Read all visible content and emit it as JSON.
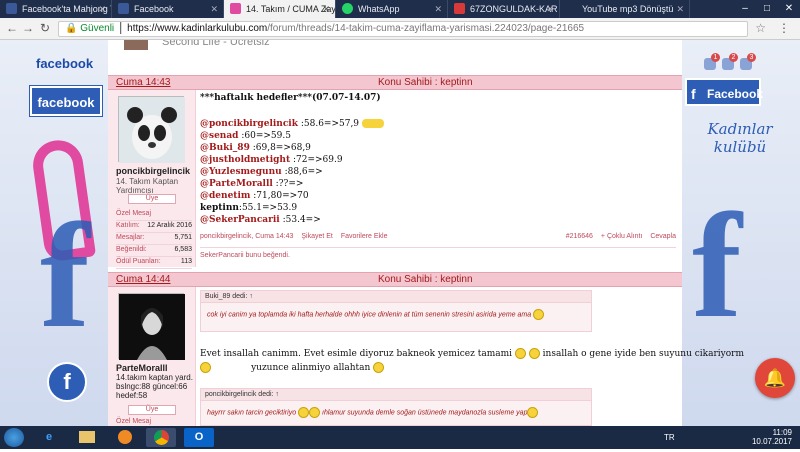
{
  "browser": {
    "tabs": [
      {
        "title": "Facebook'ta Mahjong T",
        "fav": "#3b5998"
      },
      {
        "title": "Facebook",
        "fav": "#3b5998"
      },
      {
        "title": "14. Takım / CUMA Zayıf",
        "fav": "#e04aa0",
        "active": true
      },
      {
        "title": "WhatsApp",
        "fav": "#25d366"
      },
      {
        "title": "67ZONGULDAK-KAR",
        "fav": "#d83a3a"
      },
      {
        "title": "YouTube mp3 Dönüştü",
        "fav": "#c33"
      }
    ],
    "address": {
      "secure_label": "Güvenli",
      "host": "https://www.kadinlarkulubu.com",
      "path": "/forum/threads/14-takim-cuma-zayiflama-yarismasi.224023/page-21665"
    }
  },
  "sidebar_left": {
    "facebook_text": "facebook",
    "facebook_box": "facebook",
    "circle": "f"
  },
  "sidebar_right": {
    "facebook_label": "Facebook",
    "logo_line1": "Kadınlar",
    "logo_line2": "kulübü",
    "badges": [
      "1",
      "2",
      "3"
    ]
  },
  "top_strip": {
    "text": "Second Life - Ücretsiz"
  },
  "post1": {
    "date": "Cuma 14:43",
    "owner_label": "Konu Sahibi : keptinn",
    "user": {
      "name": "poncikbirgelincik",
      "title": "14. Takım Kaptan Yardımcısı",
      "rank": "Üye",
      "private_msg": "Özel Mesaj",
      "stats": [
        {
          "label": "Katılım:",
          "value": "12 Aralık 2016"
        },
        {
          "label": "Mesajlar:",
          "value": "5,751"
        },
        {
          "label": "Beğenildi:",
          "value": "6,583"
        },
        {
          "label": "Ödül Puanları:",
          "value": "113"
        }
      ]
    },
    "heading": "***haftalık hedefler***(07.07-14.07)",
    "lines": [
      {
        "mention": "@poncikbirgelincik",
        "text": ":58.6=>57,9"
      },
      {
        "mention": "@senad",
        "text": ":60=>59.5"
      },
      {
        "mention": "@Buki_89",
        "text": ":69,8=>68,9"
      },
      {
        "mention": "@justholdmetight",
        "text": ":72=>69.9"
      },
      {
        "mention": "@Yuzlesmegunu",
        "text": ":88,6=>"
      },
      {
        "mention": "@ParteMoralll",
        "text": ":??=>"
      },
      {
        "mention": "@denetim",
        "text": ":71,80=>70"
      },
      {
        "mention": "keptinn",
        "text": ":55.1=>53.9"
      },
      {
        "mention": "@SekerPancarii",
        "text": ":53.4=>"
      }
    ],
    "footer_left": "poncikbirgelincik, Cuma 14:43",
    "report": "Şikayet Et",
    "favorite": "Favorilere Ekle",
    "post_no": "#216646",
    "multi_quote": "+ Çoklu Alıntı",
    "reply": "Cevapla",
    "liked": "SekerPancarii bunu beğendi."
  },
  "post2": {
    "date": "Cuma 14:44",
    "owner_label": "Konu Sahibi : keptinn",
    "user": {
      "name": "ParteMoralll",
      "title_lines": [
        "14.takım kaptan yard.",
        "bslngc:88 güncel:66",
        "hedef:58"
      ],
      "rank": "Üye",
      "private_msg": "Özel Mesaj"
    },
    "quote1": {
      "header": "Buki_89 dedi: ↑",
      "body": "cok iyi canim ya toplamda iki hafta herhalde ohhh iyice dinlenin at tüm senenin stresini asirida yeme ama"
    },
    "reply_line1": "Evet insallah canimm. Evet esimle diyoruz bakneok yemicez tamami",
    "reply_line1b": "insallah o gene iyide ben suyunu cikariyorm",
    "reply_line2": "yuzunce alinmiyo allahtan",
    "quote2": {
      "header": "poncikbirgelincik dedi: ↑",
      "body": "hayrrr sakın tarcin geciktiriyo",
      "body2": "ıhlamur suyunda demle soğan üstünede maydanozla susleme yap"
    }
  },
  "taskbar": {
    "lang": "TR",
    "time": "11:09",
    "date": "10.07.2017"
  }
}
